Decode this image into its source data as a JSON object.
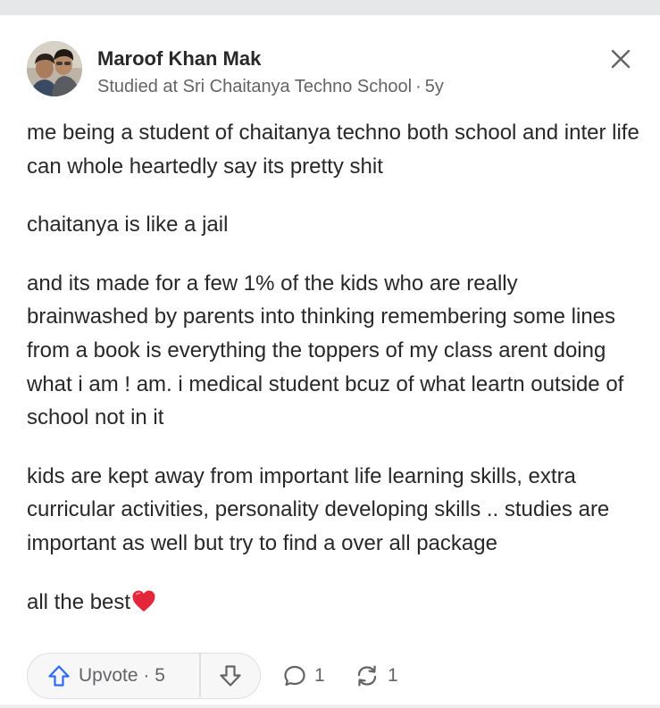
{
  "author": {
    "name": "Maroof Khan Mak",
    "credential": "Studied at Sri Chaitanya Techno School",
    "separator": "·",
    "age": "5y"
  },
  "answer": {
    "paragraphs": [
      "me being a student of chaitanya techno both school and inter life can whole heartedly say its pretty shit",
      "chaitanya is like a jail",
      "and its made for a few 1% of the kids who are really brainwashed by parents into thinking remembering some lines from a book is everything the toppers of my class arent doing what i am ! am. i medical student bcuz of what leartn outside of school not in it",
      "kids are kept away from important life learning skills, extra curricular activities, personality developing skills .. studies are important as well but try to find a over all package"
    ],
    "closing": "all the best"
  },
  "actions": {
    "upvote_label": "Upvote · 5",
    "comments_count": "1",
    "shares_count": "1"
  },
  "icons": {
    "close": "close-icon",
    "upvote": "upvote-arrow-icon",
    "downvote": "downvote-arrow-icon",
    "comment": "comment-bubble-icon",
    "share": "share-cycle-icon",
    "heart": "red-heart-emoji"
  },
  "colors": {
    "upvote_blue": "#2e69ff",
    "heart_red": "#e3263a",
    "secondary_text": "#636466"
  }
}
